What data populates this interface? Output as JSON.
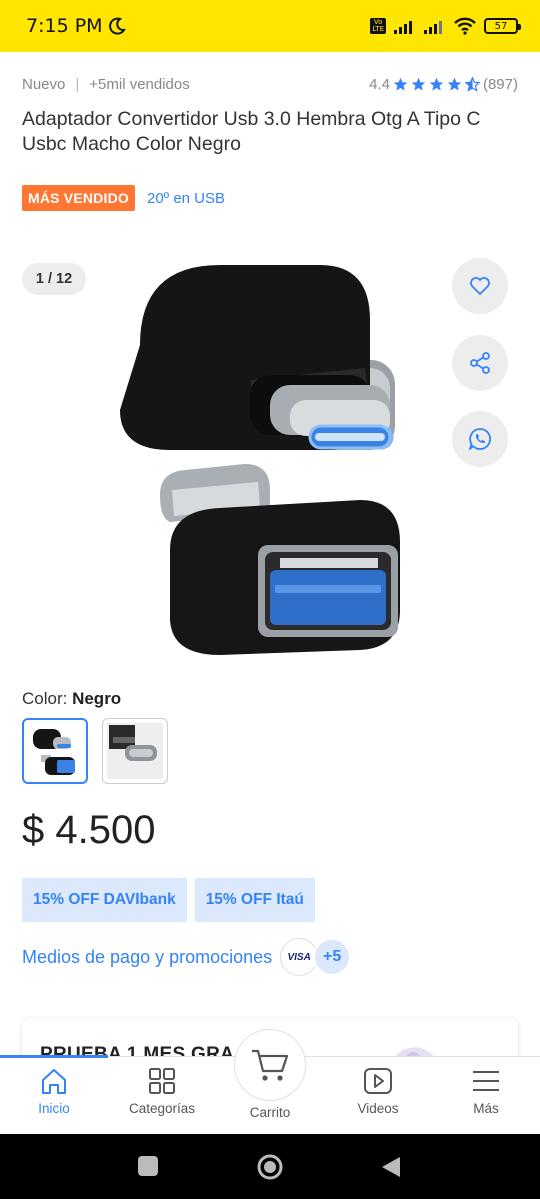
{
  "status_bar": {
    "time": "7:15 PM",
    "volte": "Vo LTE",
    "battery": "57"
  },
  "product": {
    "condition": "Nuevo",
    "sold": "+5mil vendidos",
    "rating": "4.4",
    "reviews": "(897)",
    "title": "Adaptador Convertidor Usb 3.0 Hembra Otg A Tipo C Usbc Macho Color Negro",
    "best_seller_badge": "MÁS VENDIDO",
    "rank_text": "20º en USB"
  },
  "gallery": {
    "counter": "1 / 12"
  },
  "color": {
    "label": "Color: ",
    "value": "Negro"
  },
  "price": "$ 4.500",
  "promos": [
    "15% OFF DAVIbank",
    "15% OFF Itaú"
  ],
  "payments": {
    "link": "Medios de pago y promociones",
    "visa": "VISA",
    "more": "+5"
  },
  "promo_card": {
    "text": "PRUEBA 1 MES GRA..."
  },
  "bottom_nav": {
    "items": [
      {
        "label": "Inicio",
        "icon": "home-icon"
      },
      {
        "label": "Categorías",
        "icon": "grid-icon"
      },
      {
        "label": "Carrito",
        "icon": "cart-icon"
      },
      {
        "label": "Videos",
        "icon": "play-icon"
      },
      {
        "label": "Más",
        "icon": "menu-icon"
      }
    ]
  },
  "colors": {
    "accent": "#3483fa",
    "brand_yellow": "#ffe600",
    "badge_orange": "#ff7733",
    "promo_bg": "#dce8fb"
  }
}
